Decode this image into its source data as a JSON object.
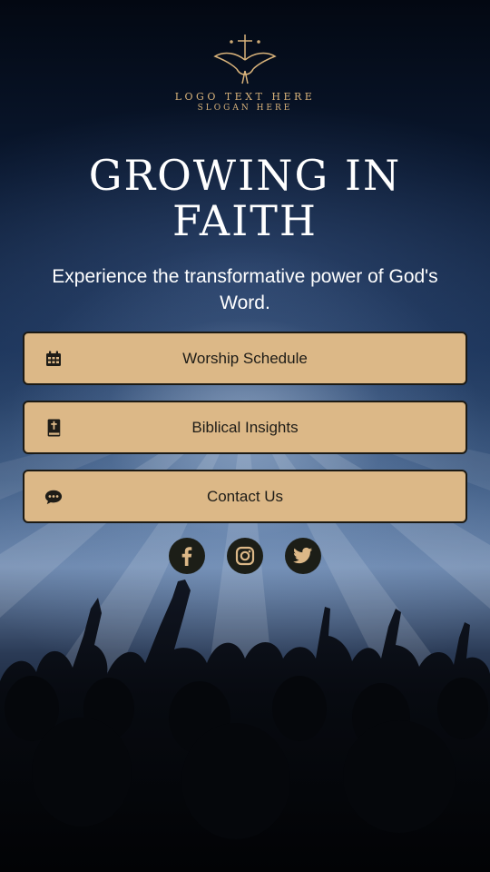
{
  "logo": {
    "text": "LOGO TEXT HERE",
    "slogan": "SLOGAN HERE",
    "icon": "cross-dove-emblem-icon",
    "color": "#d8b27a"
  },
  "hero": {
    "title": "GROWING IN FAITH",
    "subtitle": "Experience the transformative power of God's Word."
  },
  "buttons": [
    {
      "label": "Worship Schedule",
      "icon": "calendar-icon"
    },
    {
      "label": "Biblical Insights",
      "icon": "bible-icon"
    },
    {
      "label": "Contact Us",
      "icon": "chat-bubble-icon"
    }
  ],
  "social": [
    {
      "name": "facebook",
      "icon": "facebook-icon"
    },
    {
      "name": "instagram",
      "icon": "instagram-icon"
    },
    {
      "name": "twitter",
      "icon": "twitter-icon"
    }
  ],
  "colors": {
    "button_bg": "#dcb887",
    "button_border": "#1c1a14",
    "social_bg": "#1c1e17",
    "icon_accent": "#dcb887"
  }
}
